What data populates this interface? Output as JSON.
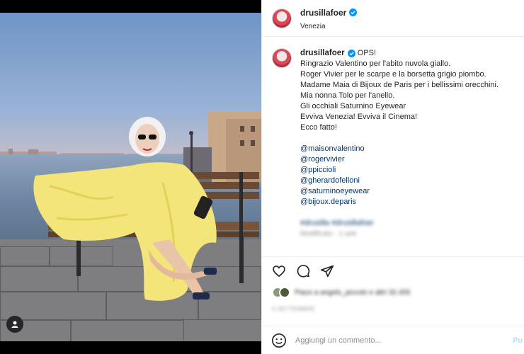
{
  "post": {
    "username": "drusillafoer",
    "location": "Venezia",
    "verified_icon": "verified-badge-icon",
    "accent_color": "#0095f6"
  },
  "caption": {
    "username": "drusillafoer",
    "lines": [
      "OPS!",
      "Ringrazio Valentino per l'abito nuvola giallo.",
      "Roger Vivier per le scarpe e la borsetta grigio piombo.",
      "Madame Maia di Bijoux de Paris per i bellissimi orecchini.",
      "Mia nonna Tolo per l'anello.",
      "Gli occhiali Saturnino Eyewear",
      "Evviva Venezia! Evviva il Cinema!",
      "Ecco fatto!"
    ],
    "mentions": [
      "@maisonvalentino",
      "@rogervivier",
      "@ppiccioli",
      "@gherardofelloni",
      "@saturninoeyewear",
      "@bijoux.deparis"
    ],
    "hashtags": "#drusilla #drusillafoer",
    "edited_time": "Modificato · 1 sett"
  },
  "actions": {
    "like_icon": "heart-icon",
    "comment_icon": "comment-icon",
    "share_icon": "share-icon"
  },
  "likes": {
    "text": "Piace a angelo_piccolo e altri 32.455"
  },
  "post_date": "4 SETTEMBRE",
  "comment": {
    "placeholder": "Aggiungi un commento...",
    "publish_label": "Pu"
  }
}
